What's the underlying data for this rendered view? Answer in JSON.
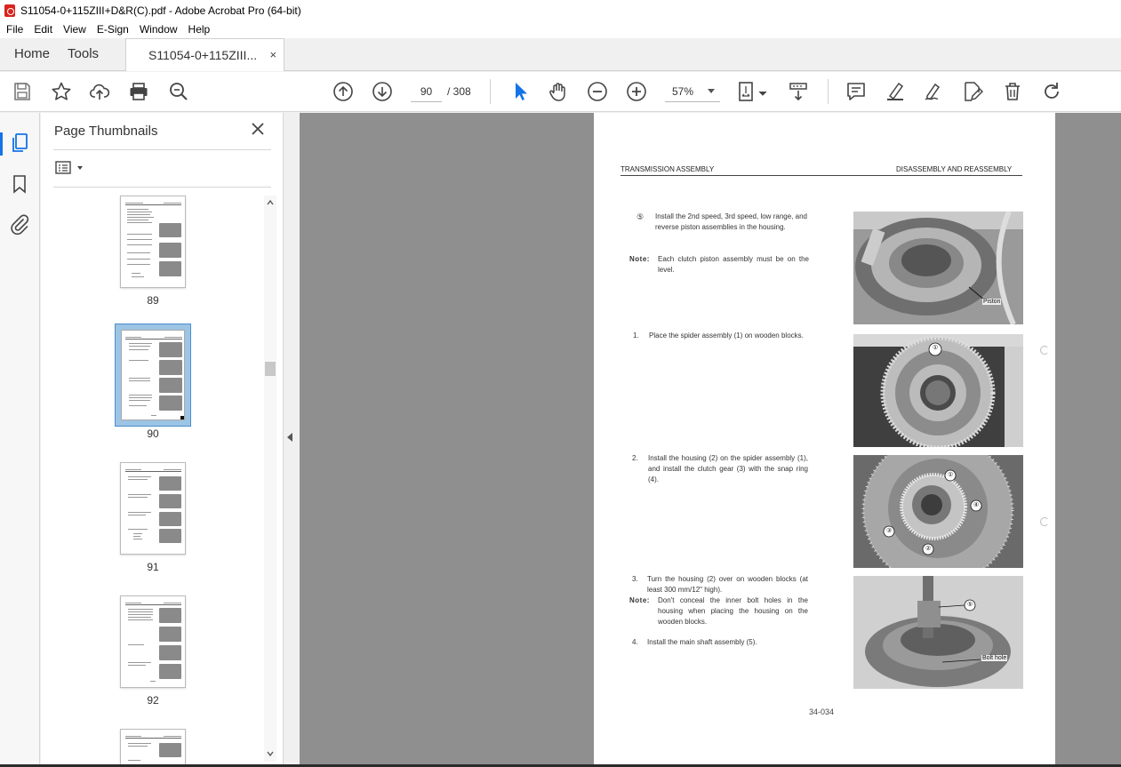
{
  "window": {
    "title": "S11054-0+115ZIII+D&R(C).pdf - Adobe Acrobat Pro (64-bit)"
  },
  "menu": [
    "File",
    "Edit",
    "View",
    "E-Sign",
    "Window",
    "Help"
  ],
  "tabs": {
    "home": "Home",
    "tools": "Tools",
    "document": "S11054-0+115ZIII...",
    "close": "×"
  },
  "toolbar": {
    "current_page": "90",
    "page_total": "/  308",
    "zoom": "57%",
    "icons": [
      "save-icon",
      "star-icon",
      "upload-icon",
      "print-icon",
      "zoom-search-icon",
      "prev-page-icon",
      "next-page-icon",
      "select-cursor-icon",
      "hand-icon",
      "zoom-out-icon",
      "zoom-in-icon",
      "page-display-icon",
      "scroll-mode-icon",
      "comment-icon",
      "highlight-icon",
      "sign-icon",
      "edit-pdf-icon",
      "delete-icon",
      "redo-icon"
    ]
  },
  "sidebar": {
    "panel_title": "Page Thumbnails",
    "thumbnails": [
      {
        "label": "89",
        "selected": false
      },
      {
        "label": "90",
        "selected": true
      },
      {
        "label": "91",
        "selected": false
      },
      {
        "label": "92",
        "selected": false
      },
      {
        "label": "",
        "selected": false
      }
    ]
  },
  "page": {
    "header_left": "TRANSMISSION ASSEMBLY",
    "header_right": "DISASSEMBLY AND REASSEMBLY",
    "step5_num": "⑤",
    "step5_text": "Install the 2nd speed, 3rd speed, low range, and reverse piston assemblies in the housing.",
    "note1_label": "Note:",
    "note1_text": "Each clutch piston assembly must be on the level.",
    "step1_num": "1.",
    "step1_text": "Place the spider assembly (1) on wooden blocks.",
    "step2_num": "2.",
    "step2_text": "Install the housing (2) on the spider assembly (1), and install the clutch gear (3) with the snap ring (4).",
    "step3_num": "3.",
    "step3_text": "Turn the housing (2) over on wooden blocks (at least 300 mm/12\" high).",
    "note2_label": "Note:",
    "note2_text": "Don't conceal the inner bolt holes in the housing when placing the housing on the wooden blocks.",
    "step4_num": "4.",
    "step4_text": "Install the main shaft assembly (5).",
    "photo1_label": "Piston",
    "photo2_labels": [
      "①"
    ],
    "photo3_labels": [
      "①",
      "④",
      "③",
      "②"
    ],
    "photo4_labels": [
      "⑤",
      "Bolt hole"
    ],
    "page_number": "34-034"
  }
}
